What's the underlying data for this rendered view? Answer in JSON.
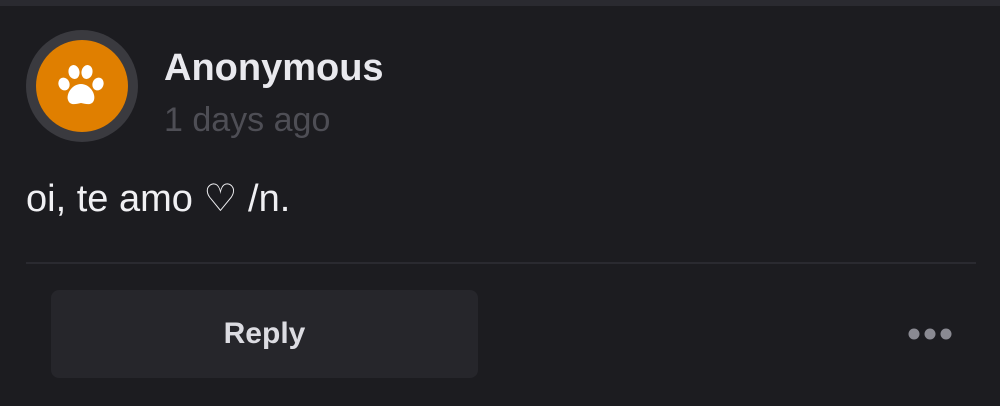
{
  "post": {
    "author": "Anonymous",
    "timestamp": "1 days ago",
    "message": "oi, te amo ♡ /n.",
    "avatar_icon": "paw-icon",
    "avatar_color": "#e07f00"
  },
  "actions": {
    "reply_label": "Reply",
    "more_icon": "more-horizontal-icon"
  }
}
